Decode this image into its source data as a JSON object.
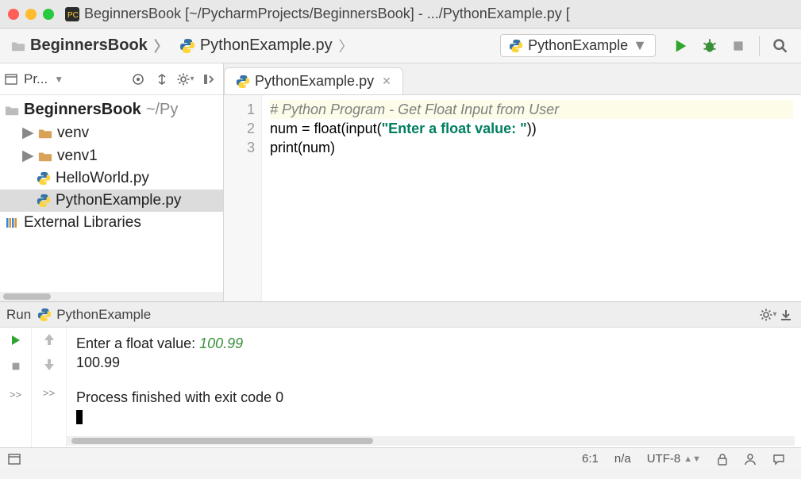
{
  "titlebar": {
    "title": "BeginnersBook [~/PycharmProjects/BeginnersBook] - .../PythonExample.py ["
  },
  "breadcrumb": {
    "items": [
      {
        "label": "BeginnersBook",
        "kind": "folder"
      },
      {
        "label": "PythonExample.py",
        "kind": "python"
      }
    ]
  },
  "run_config": {
    "selected": "PythonExample"
  },
  "project_toolbar": {
    "label": "Pr..."
  },
  "tree": {
    "root": {
      "label": "BeginnersBook",
      "suffix": "~/Py"
    },
    "children": [
      {
        "label": "venv",
        "kind": "folder"
      },
      {
        "label": "venv1",
        "kind": "folder"
      },
      {
        "label": "HelloWorld.py",
        "kind": "python"
      },
      {
        "label": "PythonExample.py",
        "kind": "python",
        "selected": true
      }
    ],
    "external": "External Libraries"
  },
  "editor": {
    "tab": "PythonExample.py",
    "gutter": [
      "1",
      "2",
      "3"
    ],
    "code": {
      "l1_comment": "# Python Program - Get Float Input from User",
      "l2_a": "num = float(input(",
      "l2_str": "\"Enter a float value: \"",
      "l2_b": "))",
      "l3": "print(num)"
    }
  },
  "run": {
    "header_prefix": "Run",
    "header_title": "PythonExample",
    "console": {
      "prompt_text": "Enter a float value: ",
      "user_input": "100.99",
      "output_line": "100.99",
      "exit_line": "Process finished with exit code 0"
    }
  },
  "statusbar": {
    "position": "6:1",
    "na": "n/a",
    "encoding": "UTF-8",
    "more": ">>",
    "more2": ">>"
  }
}
